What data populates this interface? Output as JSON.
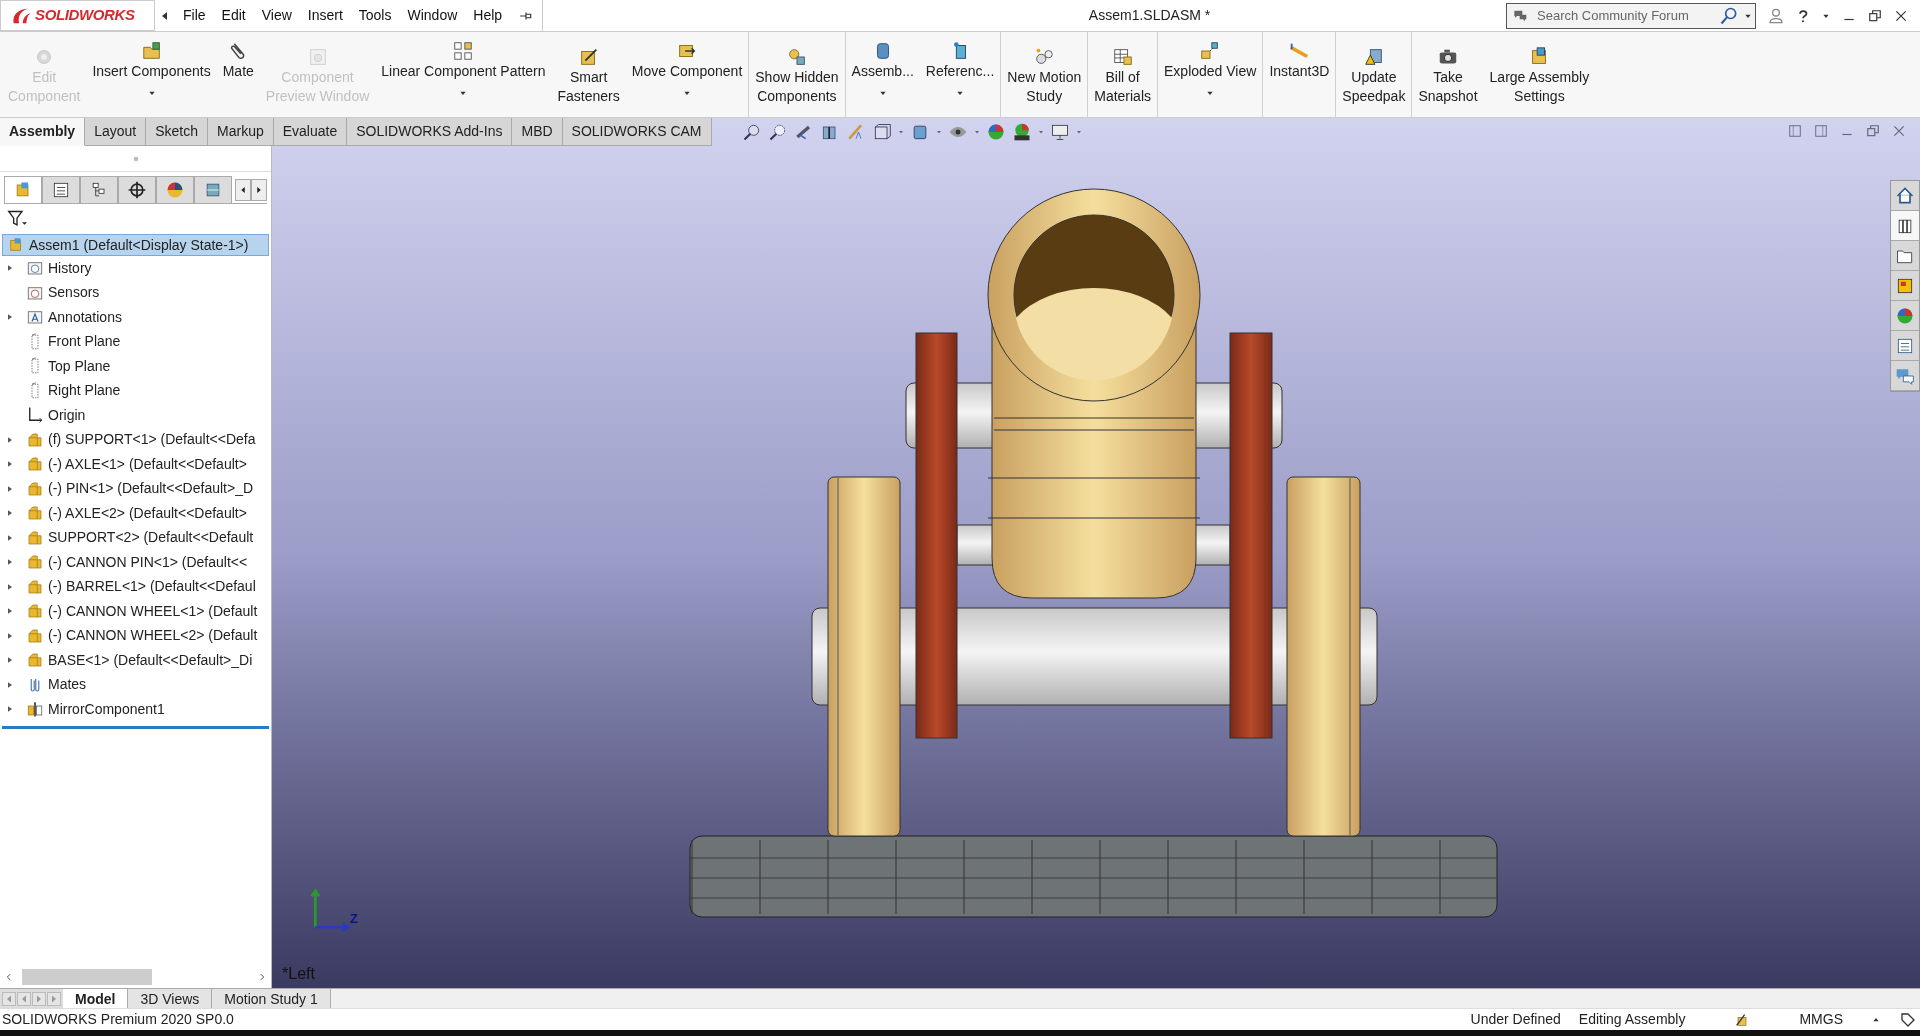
{
  "app": {
    "logo": "SOLIDWORKS",
    "menu": [
      "File",
      "Edit",
      "View",
      "Insert",
      "Tools",
      "Window",
      "Help"
    ],
    "title": "Assem1.SLDASM *",
    "search": {
      "placeholder": "Search Community Forum"
    }
  },
  "ribbon": {
    "groups": [
      [
        {
          "lines": [
            "Edit",
            "Component"
          ],
          "disabled": true,
          "dropdown": false,
          "kind": "edit"
        },
        {
          "lines": [
            "Insert Components"
          ],
          "disabled": false,
          "dropdown": true,
          "kind": "insert"
        },
        {
          "lines": [
            "Mate"
          ],
          "disabled": false,
          "dropdown": false,
          "kind": "mate"
        },
        {
          "lines": [
            "Component",
            "Preview Window"
          ],
          "disabled": true,
          "dropdown": false,
          "kind": "preview"
        },
        {
          "lines": [
            "Linear Component Pattern"
          ],
          "disabled": false,
          "dropdown": true,
          "kind": "pattern"
        },
        {
          "lines": [
            "Smart",
            "Fasteners"
          ],
          "disabled": false,
          "dropdown": false,
          "kind": "fastener"
        },
        {
          "lines": [
            "Move Component"
          ],
          "disabled": false,
          "dropdown": true,
          "kind": "move"
        }
      ],
      [
        {
          "lines": [
            "Show Hidden",
            "Components"
          ],
          "disabled": false,
          "dropdown": false,
          "kind": "show"
        }
      ],
      [
        {
          "lines": [
            "Assemb..."
          ],
          "disabled": false,
          "dropdown": true,
          "kind": "assembly"
        },
        {
          "lines": [
            "Referenc..."
          ],
          "disabled": false,
          "dropdown": true,
          "kind": "reference"
        }
      ],
      [
        {
          "lines": [
            "New Motion",
            "Study"
          ],
          "disabled": false,
          "dropdown": false,
          "kind": "motion"
        }
      ],
      [
        {
          "lines": [
            "Bill of",
            "Materials"
          ],
          "disabled": false,
          "dropdown": false,
          "kind": "bom"
        }
      ],
      [
        {
          "lines": [
            "Exploded View"
          ],
          "disabled": false,
          "dropdown": true,
          "kind": "explode"
        }
      ],
      [
        {
          "lines": [
            "Instant3D"
          ],
          "disabled": false,
          "dropdown": false,
          "kind": "instant"
        }
      ],
      [
        {
          "lines": [
            "Update",
            "Speedpak"
          ],
          "disabled": false,
          "dropdown": false,
          "kind": "speedpak"
        }
      ],
      [
        {
          "lines": [
            "Take",
            "Snapshot"
          ],
          "disabled": false,
          "dropdown": false,
          "kind": "snapshot"
        },
        {
          "lines": [
            "Large Assembly",
            "Settings"
          ],
          "disabled": false,
          "dropdown": false,
          "kind": "large"
        }
      ]
    ]
  },
  "command_tabs": [
    {
      "label": "Assembly",
      "selected": true
    },
    {
      "label": "Layout",
      "selected": false
    },
    {
      "label": "Sketch",
      "selected": false
    },
    {
      "label": "Markup",
      "selected": false
    },
    {
      "label": "Evaluate",
      "selected": false
    },
    {
      "label": "SOLIDWORKS Add-Ins",
      "selected": false
    },
    {
      "label": "MBD",
      "selected": false
    },
    {
      "label": "SOLIDWORKS CAM",
      "selected": false
    }
  ],
  "panel_tabs": [
    {
      "kind": "tree",
      "selected": true
    },
    {
      "kind": "property",
      "selected": false
    },
    {
      "kind": "config",
      "selected": false
    },
    {
      "kind": "dim",
      "selected": false
    },
    {
      "kind": "display",
      "selected": false
    },
    {
      "kind": "cam",
      "selected": false
    }
  ],
  "tree": {
    "label": "Assem1  (Default<Display State-1>)",
    "selected": true,
    "children": [
      {
        "label": "History",
        "kind": "history",
        "expandable": true,
        "selected": false
      },
      {
        "label": "Sensors",
        "kind": "sensors",
        "expandable": false,
        "selected": false
      },
      {
        "label": "Annotations",
        "kind": "annotations",
        "expandable": true,
        "selected": false
      },
      {
        "label": "Front Plane",
        "kind": "plane",
        "expandable": false,
        "selected": false
      },
      {
        "label": "Top Plane",
        "kind": "plane",
        "expandable": false,
        "selected": false
      },
      {
        "label": "Right Plane",
        "kind": "plane",
        "expandable": false,
        "selected": false
      },
      {
        "label": "Origin",
        "kind": "origin",
        "expandable": false,
        "selected": false
      },
      {
        "label": "(f) SUPPORT<1> (Default<<Defa",
        "kind": "part",
        "expandable": true,
        "selected": false
      },
      {
        "label": "(-) AXLE<1> (Default<<Default>",
        "kind": "part",
        "expandable": true,
        "selected": false
      },
      {
        "label": "(-) PIN<1> (Default<<Default>_D",
        "kind": "part",
        "expandable": true,
        "selected": false
      },
      {
        "label": "(-) AXLE<2> (Default<<Default>",
        "kind": "part",
        "expandable": true,
        "selected": false
      },
      {
        "label": "SUPPORT<2> (Default<<Default",
        "kind": "part",
        "expandable": true,
        "selected": false
      },
      {
        "label": "(-) CANNON PIN<1> (Default<<",
        "kind": "part",
        "expandable": true,
        "selected": false
      },
      {
        "label": "(-) BARREL<1> (Default<<Defaul",
        "kind": "part",
        "expandable": true,
        "selected": false
      },
      {
        "label": "(-) CANNON WHEEL<1> (Default",
        "kind": "part",
        "expandable": true,
        "selected": false
      },
      {
        "label": "(-) CANNON WHEEL<2> (Default",
        "kind": "part",
        "expandable": true,
        "selected": false
      },
      {
        "label": "BASE<1> (Default<<Default>_Di",
        "kind": "part",
        "expandable": true,
        "selected": false
      },
      {
        "label": "Mates",
        "kind": "mates",
        "expandable": true,
        "selected": false
      },
      {
        "label": "MirrorComponent1",
        "kind": "mirror",
        "expandable": true,
        "selected": false
      }
    ]
  },
  "viewport": {
    "view_label": "*Left",
    "triad_label": "Z"
  },
  "bottom_tabs": [
    {
      "label": "Model",
      "selected": true
    },
    {
      "label": "3D Views",
      "selected": false
    },
    {
      "label": "Motion Study 1",
      "selected": false
    }
  ],
  "status_bar": {
    "product": "SOLIDWORKS Premium 2020 SP0.0",
    "items": [
      "Under Defined",
      "Editing Assembly"
    ],
    "units": "MMGS"
  }
}
